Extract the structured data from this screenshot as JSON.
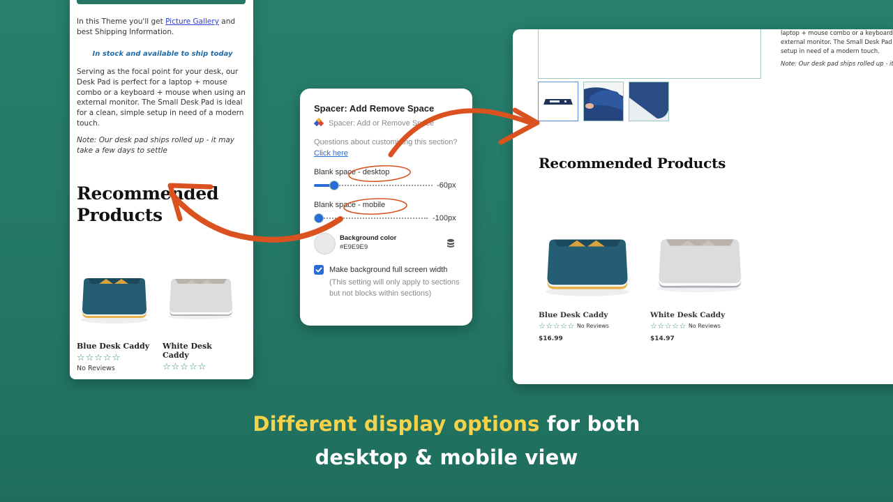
{
  "mobile_preview": {
    "intro_prefix": "In this Theme you'll get ",
    "intro_link": "Picture Gallery",
    "intro_suffix": " and best Shipping Information.",
    "stock_status": "In stock and available to ship today",
    "description": "Serving as the focal point for your desk, our Desk Pad is perfect for a laptop + mouse combo or a keyboard + mouse when using an external monitor. The Small Desk Pad is ideal for a clean, simple setup in need of a modern touch.",
    "note": "Note: Our desk pad ships rolled up - it may take a few days to settle",
    "section_heading": "Recommended Products",
    "products": [
      {
        "name": "Blue Desk Caddy",
        "rating": 0,
        "reviews": "No Reviews"
      },
      {
        "name": "White Desk Caddy",
        "rating": 0
      }
    ]
  },
  "settings_panel": {
    "title": "Spacer: Add Remove Space",
    "app_name": "Spacer: Add or Remove Space",
    "help_text": "Questions about customizing this section?",
    "help_link": "Click here",
    "desktop_slider": {
      "label": "Blank space - desktop",
      "value": "-60px",
      "fraction": 0.14
    },
    "mobile_slider": {
      "label": "Blank space - mobile",
      "value": "-100px",
      "fraction": 0.0
    },
    "background_color": {
      "label": "Background color",
      "value": "#E9E9E9"
    },
    "full_width_checkbox": {
      "label": "Make background full screen width",
      "checked": true,
      "help": "(This setting will only apply to sections but not blocks within sections)"
    }
  },
  "desktop_preview": {
    "description_lines": [
      "laptop + mouse combo or a keyboard",
      "external monitor. The Small Desk Pad is",
      "setup in need of a modern touch."
    ],
    "note": "Note: Our desk pad ships rolled up - it",
    "thumbnails": [
      "desk-pad-top-view",
      "desk-pad-hand-lift",
      "desk-pad-corner"
    ],
    "section_heading": "Recommended Products",
    "products": [
      {
        "name": "Blue Desk Caddy",
        "rating": 0,
        "reviews": "No Reviews",
        "price": "$16.99"
      },
      {
        "name": "White Desk Caddy",
        "rating": 0,
        "reviews": "No Reviews",
        "price": "$14.97"
      }
    ]
  },
  "caption": {
    "highlight": "Different display options",
    "rest_line1": " for both",
    "line2": "desktop & mobile view"
  },
  "colors": {
    "background": "#247967",
    "accent_blue": "#2a6bd6",
    "annotation_orange": "#d9521f",
    "caption_highlight": "#f6d24a",
    "star_teal": "#2e8b79"
  },
  "stars_glyph": "☆☆☆☆☆"
}
